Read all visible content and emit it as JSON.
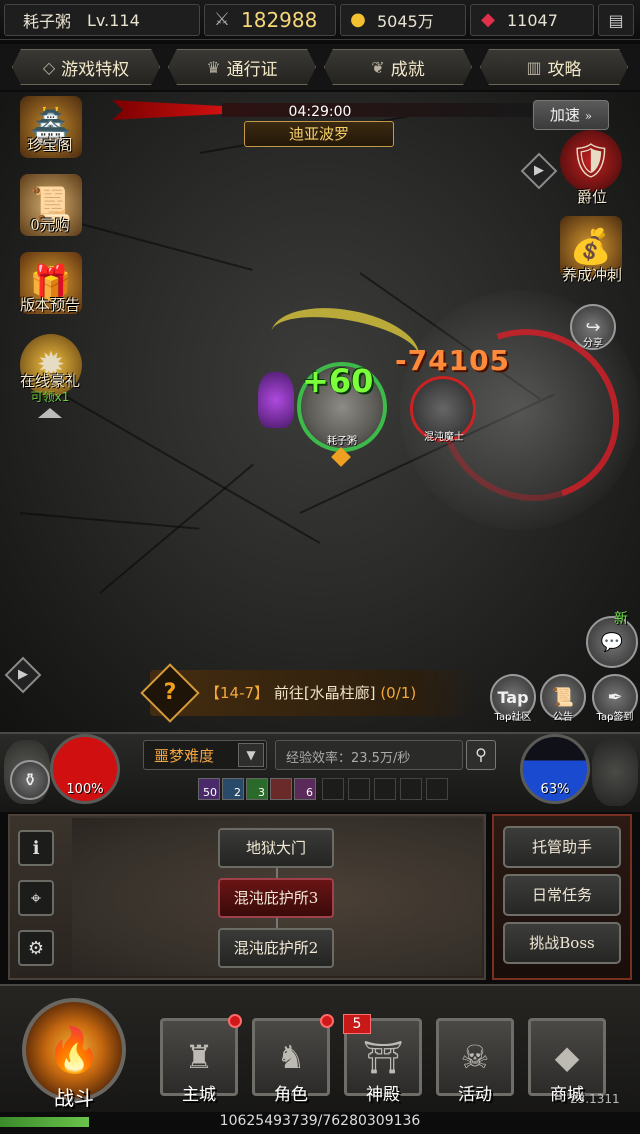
{
  "topbar": {
    "player_name": "耗子粥",
    "level": "Lv.114",
    "power": "182988",
    "gold": "5045万",
    "gems": "11047"
  },
  "tabs": [
    {
      "label": "游戏特权"
    },
    {
      "label": "通行证"
    },
    {
      "label": "成就"
    },
    {
      "label": "攻略"
    }
  ],
  "battle": {
    "timer": "04:29:00",
    "zone_name": "迪亚波罗",
    "speedup_label": "加速",
    "heal_number": "+60",
    "damage_number": "-74105",
    "hero_name": "耗子粥",
    "enemy_name": "混沌魔士"
  },
  "left_menu": [
    {
      "label": "珍宝阁"
    },
    {
      "label": "0元购"
    },
    {
      "label": "版本预告"
    },
    {
      "label": "在线豪礼",
      "sub": "可领x1"
    }
  ],
  "right_menu": [
    {
      "label": "爵位"
    },
    {
      "label": "养成冲刺"
    },
    {
      "label": "分享"
    }
  ],
  "quest": {
    "stage": "【14-7】",
    "text": "前往[水晶柱廊]",
    "progress": "(0/1)"
  },
  "round_buttons": {
    "new_badge": "新",
    "tap_label": "Tap",
    "tap_community": "Tap社区",
    "notice": "公告",
    "tap_signin": "Tap签到"
  },
  "hud": {
    "hp_percent": "100%",
    "mp_percent": "63%",
    "hp_value": 1.0,
    "mp_value": 0.63,
    "difficulty": "噩梦难度",
    "exp_rate": "经验效率：23.5万/秒",
    "buffs": [
      "50",
      "2",
      "3",
      "",
      "6"
    ]
  },
  "map_nodes": [
    {
      "label": "地狱大门",
      "active": false
    },
    {
      "label": "混沌庇护所3",
      "active": true
    },
    {
      "label": "混沌庇护所2",
      "active": false
    }
  ],
  "side_buttons": [
    {
      "label": "托管助手"
    },
    {
      "label": "日常任务"
    },
    {
      "label": "挑战Boss"
    }
  ],
  "nav": [
    {
      "label": "战斗"
    },
    {
      "label": "主城"
    },
    {
      "label": "角色"
    },
    {
      "label": "神殿",
      "badge": "5"
    },
    {
      "label": "活动"
    },
    {
      "label": "商城"
    }
  ],
  "exp_bar": {
    "text": "10625493739/76280309136",
    "fraction": 0.139
  },
  "version": "23.1311",
  "colors": {
    "accent_gold": "#f5cf6a",
    "hp_red": "#d01010",
    "mp_blue": "#1a4ad0",
    "heal_green": "#7cff3a",
    "damage_orange": "#ff8a3a"
  }
}
